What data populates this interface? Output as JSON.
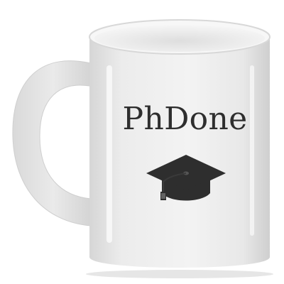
{
  "mug": {
    "printed_text": "PhDone",
    "graphic": "graduation-cap-icon",
    "colors": {
      "mug_body": "#eeeeee",
      "print_ink": "#2e2e2e",
      "background": "#ffffff"
    }
  }
}
